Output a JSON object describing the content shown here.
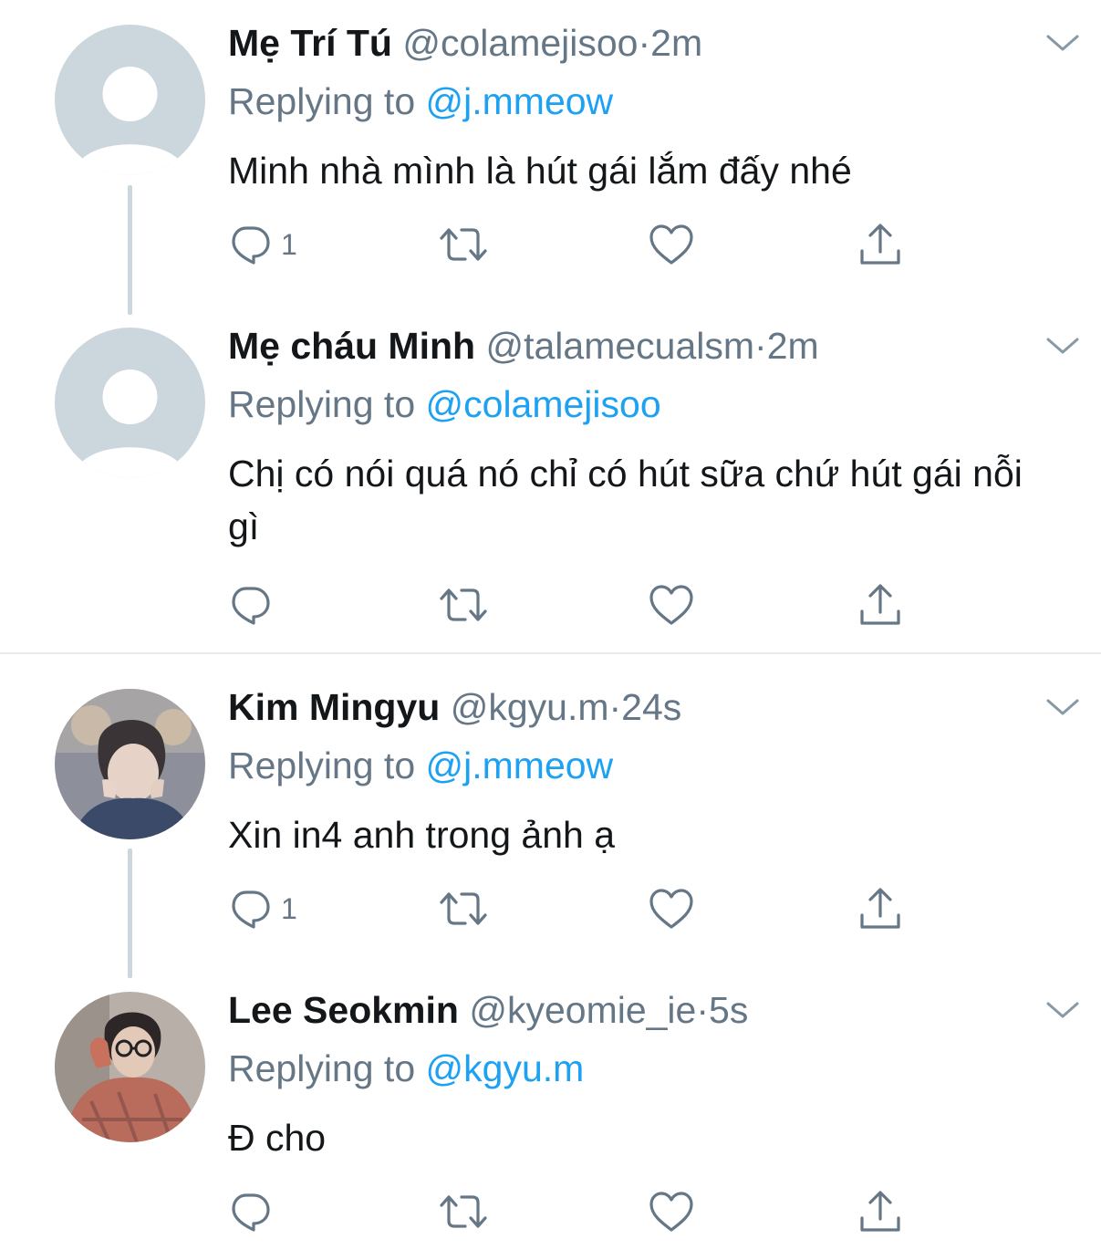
{
  "tweets": [
    {
      "name": "Mẹ Trí Tú",
      "handle": "@colamejisoo",
      "sep": "·",
      "time": "2m",
      "replying_prefix": "Replying to ",
      "replying_to": "@j.mmeow",
      "text": "Minh nhà mình là hút gái lắm đấy nhé",
      "reply_count": "1",
      "avatar": "default-avatar"
    },
    {
      "name": "Mẹ cháu Minh",
      "handle": "@talamecualsm",
      "sep": "·",
      "time": "2m",
      "replying_prefix": "Replying to ",
      "replying_to": "@colamejisoo",
      "text": "Chị có nói quá nó chỉ có hút sữa chứ hút gái nỗi gì",
      "reply_count": "",
      "avatar": "default-avatar"
    },
    {
      "name": "Kim Mingyu",
      "handle": "@kgyu.m",
      "sep": "·",
      "time": "24s",
      "replying_prefix": "Replying to ",
      "replying_to": "@j.mmeow",
      "text": "Xin in4 anh trong ảnh ạ",
      "reply_count": "1",
      "avatar": "photo-avatar"
    },
    {
      "name": "Lee Seokmin",
      "handle": "@kyeomie_ie",
      "sep": "·",
      "time": "5s",
      "replying_prefix": "Replying to ",
      "replying_to": "@kgyu.m",
      "text": "Đ cho",
      "reply_count": "",
      "avatar": "photo-avatar"
    }
  ],
  "icons": {
    "reply": "reply-icon",
    "retweet": "retweet-icon",
    "like": "like-icon",
    "share": "share-icon",
    "more": "chevron-down-icon"
  },
  "colors": {
    "text": "#14171a",
    "secondary": "#657786",
    "mention": "#1da1f2",
    "icon": "#657786",
    "thread_line": "#ccd6dd",
    "default_avatar_bg": "#ccd6dd"
  }
}
